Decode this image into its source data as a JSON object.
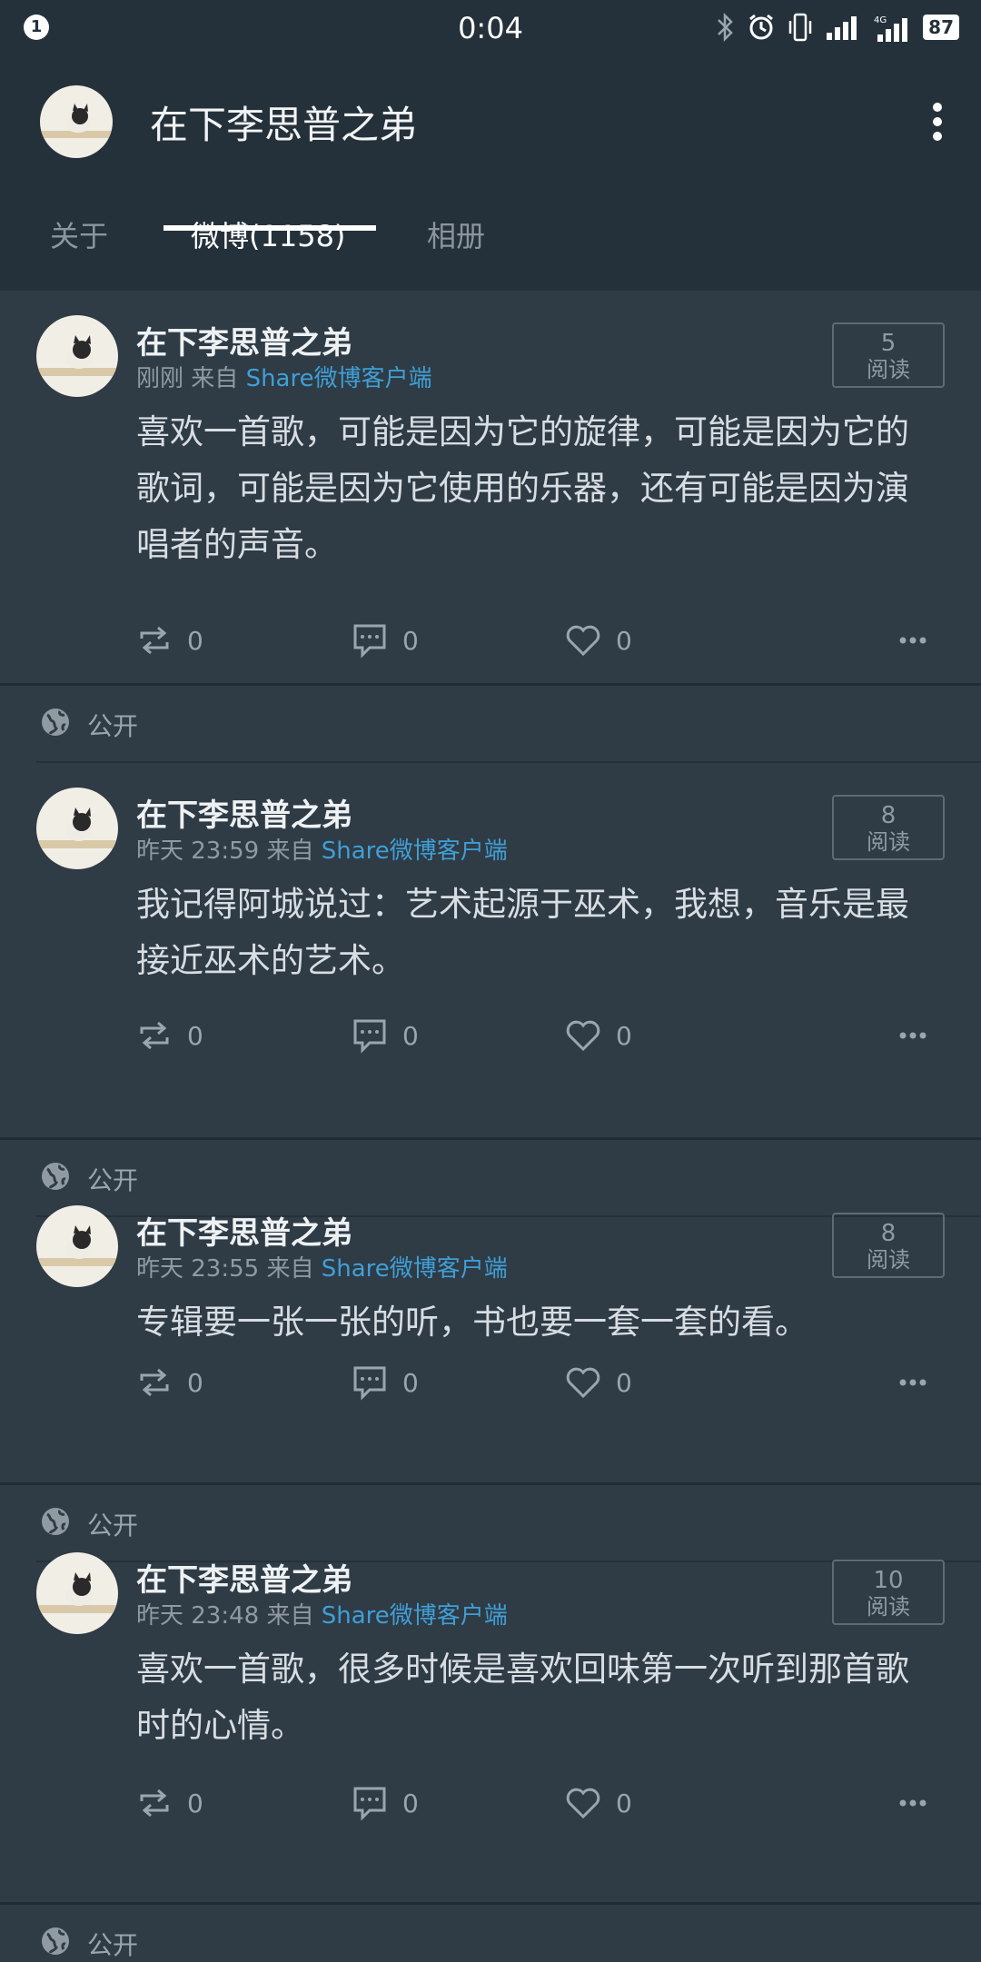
{
  "status_bar": {
    "notification_count": "1",
    "time": "0:04",
    "battery": "87",
    "network_label": "4G"
  },
  "header": {
    "title": "在下李思普之弟"
  },
  "tabs": [
    {
      "label": "关于",
      "active": false
    },
    {
      "label": "微博(1158)",
      "active": true
    },
    {
      "label": "相册",
      "active": false
    }
  ],
  "posts": [
    {
      "name": "在下李思普之弟",
      "time": "刚刚",
      "from": "来自",
      "source": "Share微博客户端",
      "read_count": "5",
      "read_label": "阅读",
      "text": "喜欢一首歌，可能是因为它的旋律，可能是因为它的歌词，可能是因为它使用的乐器，还有可能是因为演唱者的声音。",
      "repost": "0",
      "comment": "0",
      "like": "0",
      "visibility": "公开"
    },
    {
      "name": "在下李思普之弟",
      "time": "昨天 23:59",
      "from": "来自",
      "source": "Share微博客户端",
      "read_count": "8",
      "read_label": "阅读",
      "text": "我记得阿城说过：艺术起源于巫术，我想，音乐是最接近巫术的艺术。",
      "repost": "0",
      "comment": "0",
      "like": "0",
      "visibility": "公开"
    },
    {
      "name": "在下李思普之弟",
      "time": "昨天 23:55",
      "from": "来自",
      "source": "Share微博客户端",
      "read_count": "8",
      "read_label": "阅读",
      "text": "专辑要一张一张的听，书也要一套一套的看。",
      "repost": "0",
      "comment": "0",
      "like": "0",
      "visibility": "公开"
    },
    {
      "name": "在下李思普之弟",
      "time": "昨天 23:48",
      "from": "来自",
      "source": "Share微博客户端",
      "read_count": "10",
      "read_label": "阅读",
      "text": "喜欢一首歌，很多时候是喜欢回味第一次听到那首歌时的心情。",
      "repost": "0",
      "comment": "0",
      "like": "0",
      "visibility": "公开"
    }
  ],
  "icons": {
    "more": "more-vertical-icon",
    "repost": "repost-icon",
    "comment": "comment-icon",
    "like": "heart-icon",
    "post_more": "more-horizontal-icon",
    "public": "globe-icon",
    "bluetooth": "bluetooth-icon",
    "alarm": "alarm-icon",
    "vibrate": "vibrate-icon",
    "signal": "signal-icon"
  },
  "colors": {
    "background": "#2f3b45",
    "header": "#25313a",
    "link": "#3f9fd6",
    "text": "#d7dde2",
    "muted": "#8f9aa3"
  }
}
